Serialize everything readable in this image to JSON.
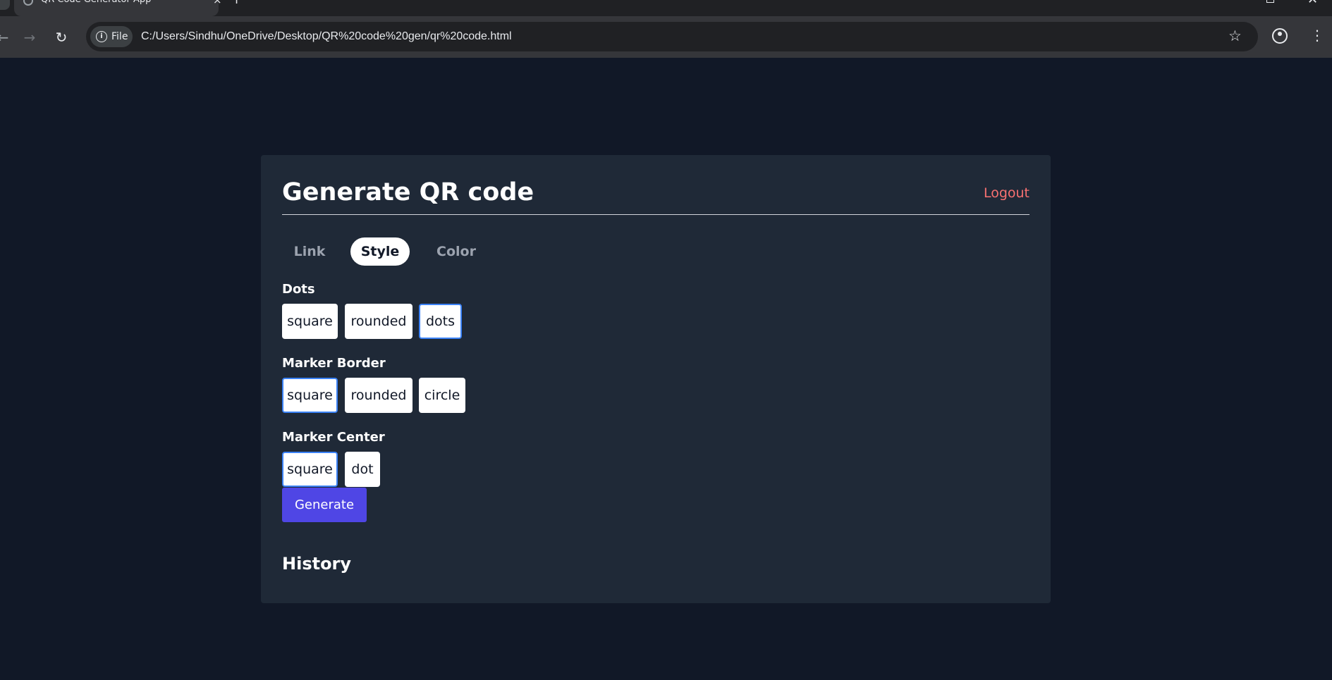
{
  "browser": {
    "tab_title": "QR Code Generator App",
    "tab_close": "×",
    "new_tab": "+",
    "window_close": "✕",
    "chip_label": "File",
    "url": "C:/Users/Sindhu/OneDrive/Desktop/QR%20code%20gen/qr%20code.html",
    "icons": {
      "back": "arrow-left-icon",
      "forward": "arrow-right-icon",
      "reload": "reload-icon",
      "info": "info-icon",
      "star": "star-icon",
      "profile": "profile-icon",
      "menu": "kebab-menu-icon"
    }
  },
  "app": {
    "title": "Generate QR code",
    "logout_label": "Logout",
    "tabs": [
      {
        "label": "Link",
        "active": false
      },
      {
        "label": "Style",
        "active": true
      },
      {
        "label": "Color",
        "active": false
      }
    ],
    "sections": [
      {
        "label": "Dots",
        "options": [
          "square",
          "rounded",
          "dots"
        ],
        "selected": "dots"
      },
      {
        "label": "Marker Border",
        "options": [
          "square",
          "rounded",
          "circle"
        ],
        "selected": "square"
      },
      {
        "label": "Marker Center",
        "options": [
          "square",
          "dot"
        ],
        "selected": "square"
      }
    ],
    "generate_label": "Generate",
    "history_title": "History"
  },
  "colors": {
    "page_bg": "#111827",
    "card_bg": "#1f2937",
    "accent": "#4f46e5",
    "logout": "#f87171",
    "selected_border": "#3b82f6"
  }
}
